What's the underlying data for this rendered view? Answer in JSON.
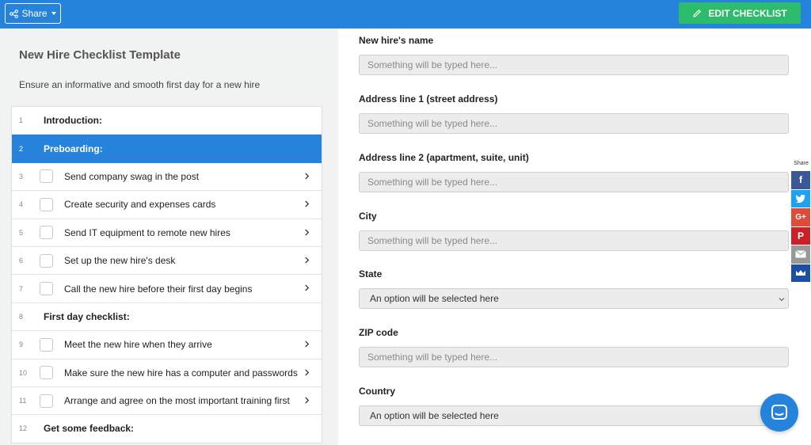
{
  "topbar": {
    "share_label": "Share",
    "edit_label": "EDIT CHECKLIST",
    "accent": "#2683dc",
    "edit_color": "#2dbb6c"
  },
  "checklist": {
    "title": "New Hire Checklist Template",
    "description": "Ensure an informative and smooth first day for a new hire",
    "items": [
      {
        "num": "1",
        "label": "Introduction:",
        "type": "section",
        "active": false
      },
      {
        "num": "2",
        "label": "Preboarding:",
        "type": "section",
        "active": true
      },
      {
        "num": "3",
        "label": "Send company swag in the post",
        "type": "task"
      },
      {
        "num": "4",
        "label": "Create security and expenses cards",
        "type": "task"
      },
      {
        "num": "5",
        "label": "Send IT equipment to remote new hires",
        "type": "task"
      },
      {
        "num": "6",
        "label": "Set up the new hire's desk",
        "type": "task"
      },
      {
        "num": "7",
        "label": "Call the new hire before their first day begins",
        "type": "task"
      },
      {
        "num": "8",
        "label": "First day checklist:",
        "type": "section",
        "active": false
      },
      {
        "num": "9",
        "label": "Meet the new hire when they arrive",
        "type": "task"
      },
      {
        "num": "10",
        "label": "Make sure the new hire has a computer and passwords",
        "type": "task"
      },
      {
        "num": "11",
        "label": "Arrange and agree on the most important training first",
        "type": "task"
      },
      {
        "num": "12",
        "label": "Get some feedback:",
        "type": "section",
        "active": false
      }
    ]
  },
  "form": {
    "fields": [
      {
        "label": "New hire's name",
        "kind": "text",
        "placeholder": "Something will be typed here..."
      },
      {
        "label": "Address line 1 (street address)",
        "kind": "text",
        "placeholder": "Something will be typed here..."
      },
      {
        "label": "Address line 2 (apartment, suite, unit)",
        "kind": "text",
        "placeholder": "Something will be typed here..."
      },
      {
        "label": "City",
        "kind": "text",
        "placeholder": "Something will be typed here..."
      },
      {
        "label": "State",
        "kind": "select",
        "placeholder": "An option will be selected here"
      },
      {
        "label": "ZIP code",
        "kind": "text",
        "placeholder": "Something will be typed here..."
      },
      {
        "label": "Country",
        "kind": "select",
        "placeholder": "An option will be selected here"
      }
    ]
  },
  "social": {
    "label": "Share",
    "buttons": [
      {
        "name": "facebook",
        "icon": "facebook-icon",
        "glyph": "f",
        "color": "#3b5998"
      },
      {
        "name": "twitter",
        "icon": "twitter-icon",
        "glyph": "",
        "color": "#1da1f2"
      },
      {
        "name": "google-plus",
        "icon": "google-plus-icon",
        "glyph": "G+",
        "color": "#dd4b39"
      },
      {
        "name": "pinterest",
        "icon": "pinterest-icon",
        "glyph": "P",
        "color": "#cb2027"
      },
      {
        "name": "email",
        "icon": "email-icon",
        "glyph": "",
        "color": "#999999"
      },
      {
        "name": "sumome",
        "icon": "crown-icon",
        "glyph": "",
        "color": "#1b4fa3"
      }
    ]
  },
  "chat": {
    "icon": "chat-icon"
  }
}
